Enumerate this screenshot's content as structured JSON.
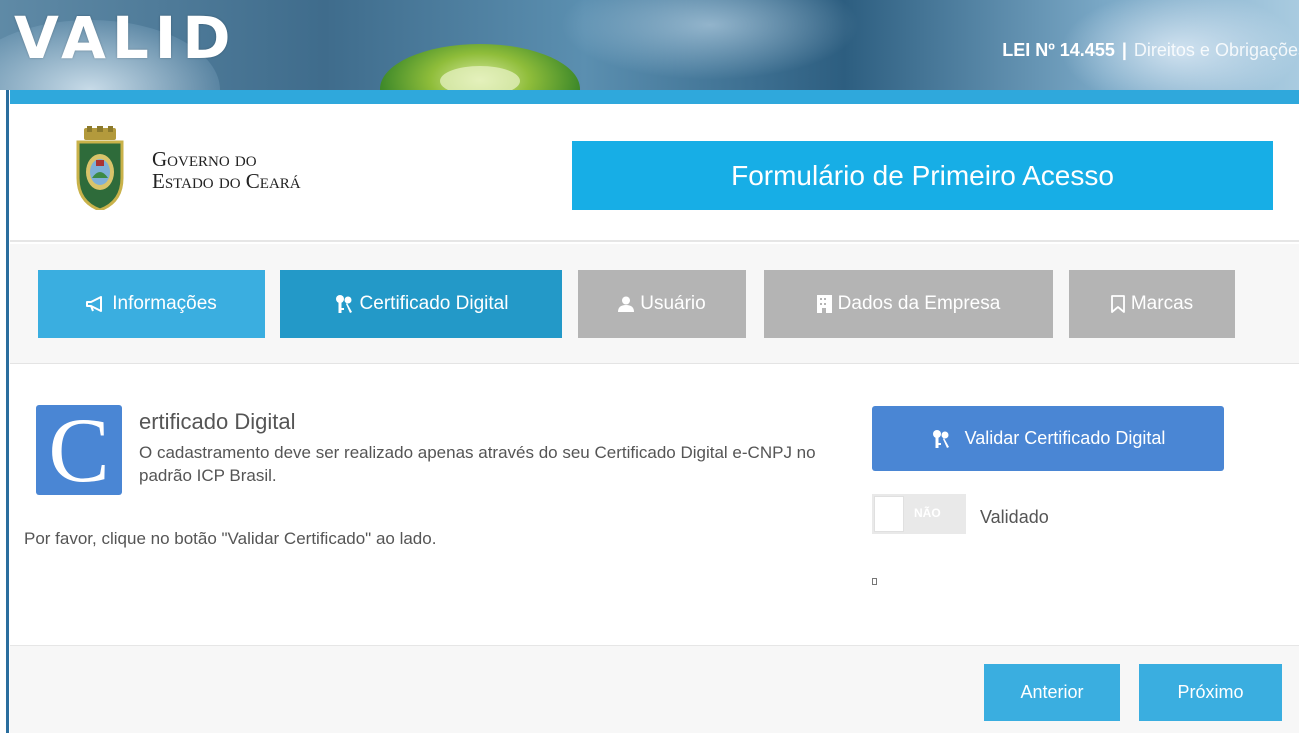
{
  "banner": {
    "logo": "VALID",
    "law_number": "LEI Nº 14.455",
    "law_separator": "|",
    "law_rest": "Direitos e Obrigações"
  },
  "header": {
    "gov_line1": "Governo do",
    "gov_line2": "Estado do Ceará",
    "form_title": "Formulário de Primeiro Acesso"
  },
  "tabs": [
    {
      "label": "Informações",
      "icon": "megaphone-icon",
      "state": "done"
    },
    {
      "label": "Certificado Digital",
      "icon": "keys-icon",
      "state": "active"
    },
    {
      "label": "Usuário",
      "icon": "user-icon",
      "state": "disabled"
    },
    {
      "label": "Dados da Empresa",
      "icon": "building-icon",
      "state": "disabled"
    },
    {
      "label": "Marcas",
      "icon": "bookmark-icon",
      "state": "disabled"
    }
  ],
  "certificate": {
    "dropcap": "C",
    "heading": "ertificado Digital",
    "description": "O cadastramento deve ser realizado apenas através do seu Certificado Digital e-CNPJ no padrão ICP Brasil.",
    "note": "Por favor, clique no botão \"Validar Certificado\" ao lado.",
    "validate_button": "Validar Certificado Digital",
    "toggle_text": "NÃO",
    "toggle_label": "Validado"
  },
  "footer": {
    "previous": "Anterior",
    "next": "Próximo"
  },
  "colors": {
    "accent": "#17aee6",
    "tab_done": "#3aaee0",
    "tab_active": "#2399c8",
    "tab_disabled": "#b4b4b4",
    "button_blue": "#4a86d4"
  }
}
